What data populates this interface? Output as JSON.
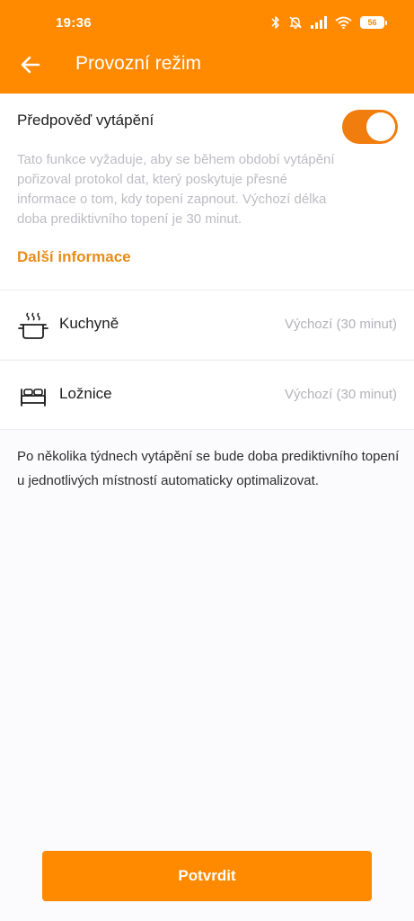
{
  "status_bar": {
    "time": "19:36",
    "battery_level": "56",
    "icons": [
      "bluetooth-icon",
      "mute-icon",
      "signal-icon",
      "wifi-icon",
      "battery-icon"
    ]
  },
  "header": {
    "title": "Provozní režim",
    "back_icon": "arrow-left-icon"
  },
  "predictive_heating": {
    "label": "Předpověď vytápění",
    "enabled": true,
    "description": "Tato funkce vyžaduje, aby se během období vytápění pořizoval protokol dat, který poskytuje přesné informace o tom, kdy topení zapnout. Výchozí délka doba prediktivního topení je 30 minut.",
    "more_info_label": "Další informace"
  },
  "rooms": [
    {
      "name": "Kuchyně",
      "value": "Výchozí (30 minut)",
      "icon": "cooking-pot-icon"
    },
    {
      "name": "Ložnice",
      "value": "Výchozí (30 minut)",
      "icon": "bed-icon"
    }
  ],
  "footer_note": "Po několika týdnech vytápění se bude doba prediktivního topení u jednotlivých místností automaticky optimalizovat.",
  "confirm_button": {
    "label": "Potvrdit"
  },
  "colors": {
    "accent": "#ff8a00",
    "toggle": "#f07d0e",
    "link": "#e88c17",
    "background": "#fbfafd"
  }
}
